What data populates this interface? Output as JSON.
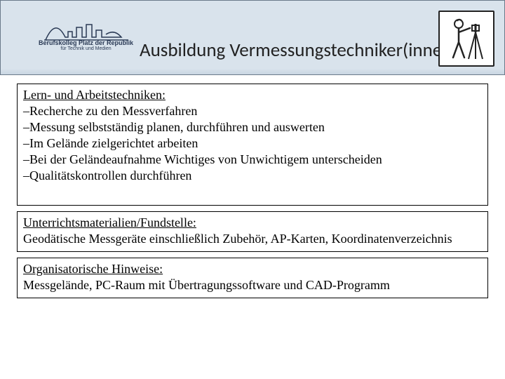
{
  "header": {
    "logo_text": "Berufskolleg Platz der Republik",
    "logo_sub": "für Technik und Medien",
    "title": "Ausbildung Vermessungstechniker(innen)"
  },
  "box1": {
    "heading": "Lern- und Arbeitstechniken:",
    "items": [
      "Recherche zu den Messverfahren",
      "Messung selbstständig planen, durchführen und auswerten",
      "Im Gelände zielgerichtet arbeiten",
      "Bei der Geländeaufnahme Wichtiges von Unwichtigem unterscheiden",
      "Qualitätskontrollen durchführen"
    ]
  },
  "box2": {
    "heading": "Unterrichtsmaterialien/Fundstelle:",
    "body": "Geodätische Messgeräte einschließlich Zubehör, AP-Karten, Koordinatenverzeichnis"
  },
  "box3": {
    "heading": "Organisatorische Hinweise:",
    "body": "Messgelände, PC-Raum mit Übertragungssoftware und CAD-Programm"
  }
}
